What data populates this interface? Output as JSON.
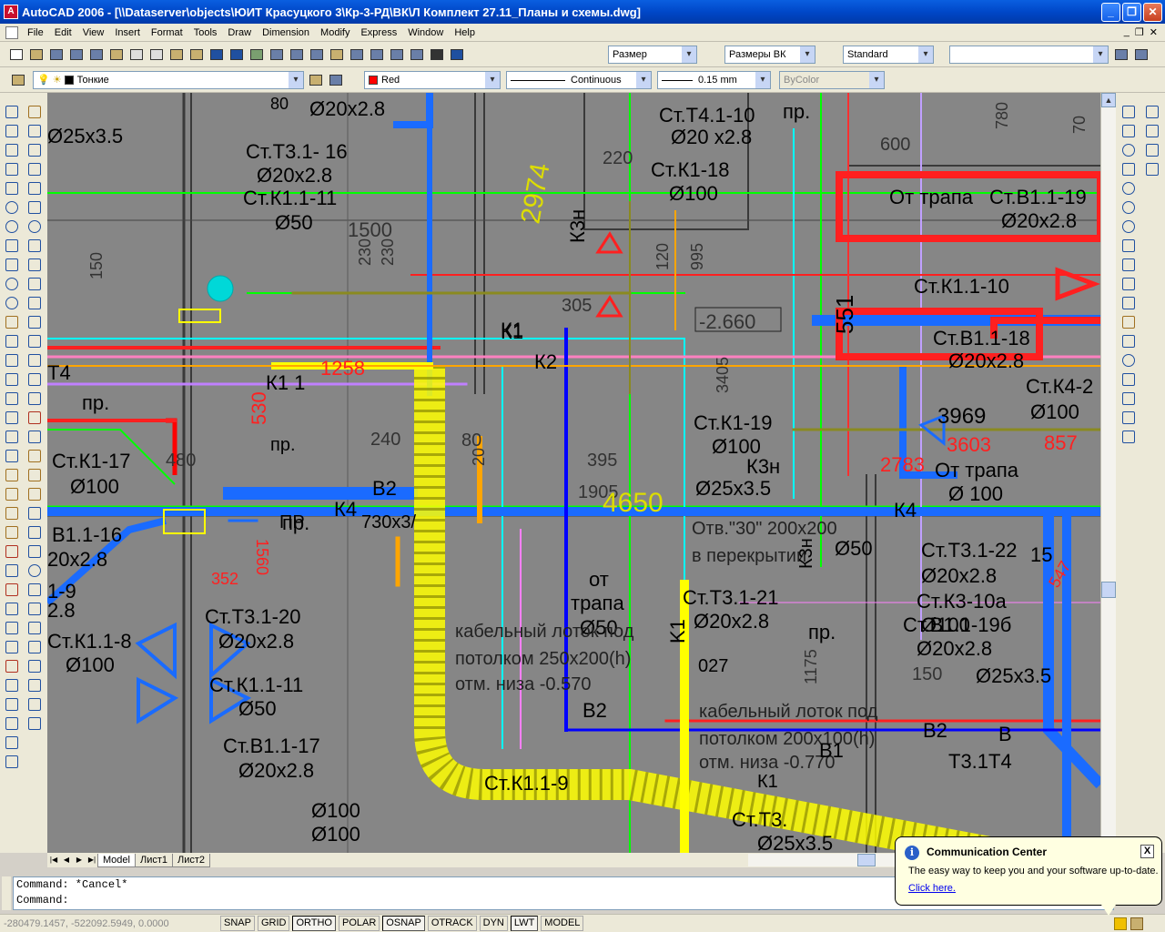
{
  "window": {
    "title": "AutoCAD 2006 - [\\\\Dataserver\\objects\\ЮИТ Красуцкого 3\\Кр-3-РД\\ВК\\Л Комплект 27.11_Планы и схемы.dwg]",
    "app_icon": "autocad-icon",
    "minimize": "_",
    "maximize": "❐",
    "close": "✕"
  },
  "menu": {
    "items": [
      "File",
      "Edit",
      "View",
      "Insert",
      "Format",
      "Tools",
      "Draw",
      "Dimension",
      "Modify",
      "Express",
      "Window",
      "Help"
    ],
    "mdi": [
      "_",
      "❐",
      "✕"
    ]
  },
  "toolbar": {
    "dimstyle": "Размер",
    "textstyle": "Размеры ВК",
    "tablestyle": "Standard",
    "named_view": "",
    "layer": "Тонкие",
    "color": "Red",
    "color_hex": "#ff0000",
    "linetype": "Continuous",
    "lineweight": "0.15 mm",
    "plotstyle": "ByColor"
  },
  "drawing": {
    "background": "#868686",
    "labels": [
      {
        "t": "Ø25x3.5"
      },
      {
        "t": "80"
      },
      {
        "t": "Ø20x2.8"
      },
      {
        "t": "Ст.Т3.1- 16"
      },
      {
        "t": "Ø20x2.8"
      },
      {
        "t": "Ст.К1.1-11"
      },
      {
        "t": "Ø50"
      },
      {
        "t": "1500"
      },
      {
        "t": "Ст.Т4.1-10"
      },
      {
        "t": "Ø20 x2.8"
      },
      {
        "t": "пр."
      },
      {
        "t": "Ст.К1-18"
      },
      {
        "t": "Ø100"
      },
      {
        "t": "220"
      },
      {
        "t": "600"
      },
      {
        "t": "780"
      },
      {
        "t": "70"
      },
      {
        "t": "От трапа"
      },
      {
        "t": "Ст.В1.1-19"
      },
      {
        "t": "Ø20x2.8"
      },
      {
        "t": "К3н"
      },
      {
        "t": "305"
      },
      {
        "t": "К1"
      },
      {
        "t": "К2"
      },
      {
        "t": "-2.660"
      },
      {
        "t": "551"
      },
      {
        "t": "Ст.К1.1-10"
      },
      {
        "t": "Ст.В1.1-18"
      },
      {
        "t": "Ø20x2.8"
      },
      {
        "t": "Ст.К4-2"
      },
      {
        "t": "Ø100"
      },
      {
        "t": "3969"
      },
      {
        "t": "3603"
      },
      {
        "t": "857"
      },
      {
        "t": "2783"
      },
      {
        "t": "От трапа"
      },
      {
        "t": "Ø 100"
      },
      {
        "t": "Т4"
      },
      {
        "t": "пр."
      },
      {
        "t": "1258"
      },
      {
        "t": "530"
      },
      {
        "t": "Ст.К1-17"
      },
      {
        "t": "Ø100"
      },
      {
        "t": "В1.1-16"
      },
      {
        "t": "20x2.8"
      },
      {
        "t": "В2"
      },
      {
        "t": "К4"
      },
      {
        "t": "пр."
      },
      {
        "t": "1560"
      },
      {
        "t": "Ст.К1-19"
      },
      {
        "t": "Ø100"
      },
      {
        "t": "К3н"
      },
      {
        "t": "Ø25x3.5"
      },
      {
        "t": "395"
      },
      {
        "t": "1905"
      },
      {
        "t": "К4"
      },
      {
        "t": "Ст.Т3.1-22"
      },
      {
        "t": "Ø20x2.8"
      },
      {
        "t": "Ст.К3-10а"
      },
      {
        "t": "Ø100"
      },
      {
        "t": "Ст.В1.1-19б"
      },
      {
        "t": "Ø20x2.8"
      },
      {
        "t": "Ø25x3.5"
      },
      {
        "t": "Отв.\"30\" 200x200"
      },
      {
        "t": "в перекрытии"
      },
      {
        "t": "Ø50"
      },
      {
        "t": "от"
      },
      {
        "t": "трапа"
      },
      {
        "t": "Ø50"
      },
      {
        "t": "Ст.Т3.1-21"
      },
      {
        "t": "Ø20x2.8"
      },
      {
        "t": "пр."
      },
      {
        "t": "1175"
      },
      {
        "t": "150"
      },
      {
        "t": "Ст.Т3.1-20"
      },
      {
        "t": "Ø20x2.8"
      },
      {
        "t": "Ст.К1.1-8"
      },
      {
        "t": "Ø100"
      },
      {
        "t": "Ст.К1.1-11"
      },
      {
        "t": "Ø50"
      },
      {
        "t": "кабельный лоток под"
      },
      {
        "t": "потолком 250x200(h)"
      },
      {
        "t": "отм. низа -0.570"
      },
      {
        "t": "В2"
      },
      {
        "t": "кабельный лоток под"
      },
      {
        "t": "потолком 200x100(h)"
      },
      {
        "t": "отм. низа -0.770"
      },
      {
        "t": "Ст.В1.1-17"
      },
      {
        "t": "Ø20x2.8"
      },
      {
        "t": "Ø100"
      },
      {
        "t": "Ø100"
      },
      {
        "t": "Ст.Т3."
      },
      {
        "t": "Ø25x3.5"
      },
      {
        "t": "В2"
      },
      {
        "t": "Т3.1Т4"
      },
      {
        "t": "В1"
      },
      {
        "t": "027"
      },
      {
        "t": "К1"
      },
      {
        "t": "Ст.К1.1-9"
      },
      {
        "t": "2974"
      },
      {
        "t": "4650"
      },
      {
        "t": "K1"
      },
      {
        "t": "К3н"
      },
      {
        "t": "К1"
      },
      {
        "t": "352"
      },
      {
        "t": "2.8"
      },
      {
        "t": "1-9"
      },
      {
        "t": "120"
      },
      {
        "t": "995"
      },
      {
        "t": "3405"
      },
      {
        "t": "240"
      },
      {
        "t": "80"
      },
      {
        "t": "20"
      },
      {
        "t": "480"
      },
      {
        "t": "150"
      },
      {
        "t": "230"
      },
      {
        "t": "230"
      },
      {
        "t": "К1 1"
      },
      {
        "t": "пр."
      },
      {
        "t": "ПР"
      },
      {
        "t": "730x3/"
      },
      {
        "t": "15"
      },
      {
        "t": "547"
      },
      {
        "t": "В"
      }
    ]
  },
  "tabs": {
    "nav": [
      "|◀",
      "◀",
      "▶",
      "▶|"
    ],
    "items": [
      "Model",
      "Лист1",
      "Лист2"
    ]
  },
  "command": {
    "line1": "Command: *Cancel*",
    "line2": "Command:"
  },
  "status": {
    "coords": "-280479.1457, -522092.5949, 0.0000",
    "buttons": [
      "SNAP",
      "GRID",
      "ORTHO",
      "POLAR",
      "OSNAP",
      "OTRACK",
      "DYN",
      "LWT",
      "MODEL"
    ],
    "active": [
      "ORTHO",
      "OSNAP",
      "LWT"
    ]
  },
  "balloon": {
    "title": "Communication Center",
    "text": "The easy way to keep you and your software up-to-date.",
    "link": "Click here.",
    "close": "X"
  }
}
